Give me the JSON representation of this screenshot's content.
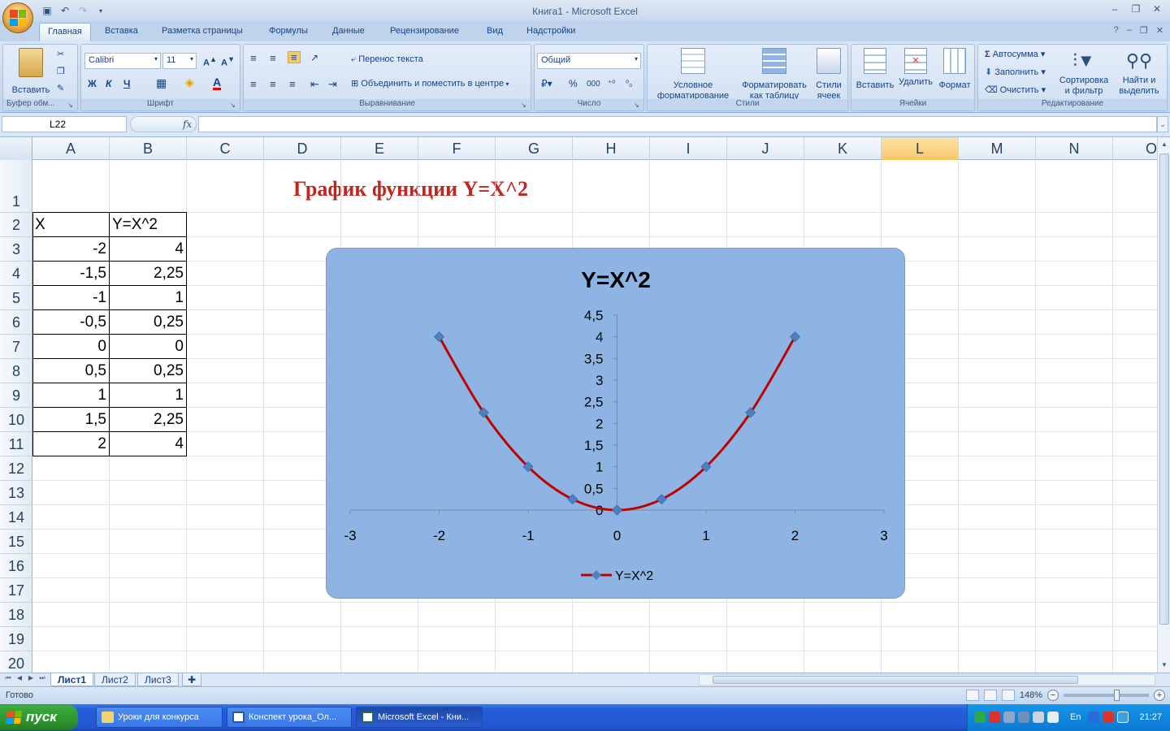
{
  "window": {
    "title": "Книга1 - Microsoft Excel",
    "min": "–",
    "restore": "❐",
    "close": "✕"
  },
  "ribbon_tabs": [
    "Главная",
    "Вставка",
    "Разметка страницы",
    "Формулы",
    "Данные",
    "Рецензирование",
    "Вид",
    "Надстройки"
  ],
  "ribbon": {
    "clipboard": {
      "paste": "Вставить",
      "label": "Буфер обм..."
    },
    "font": {
      "name": "Calibri",
      "size": "11",
      "bold": "Ж",
      "italic": "К",
      "underline": "Ч",
      "label": "Шрифт"
    },
    "alignment": {
      "wrap": "Перенос текста",
      "merge": "Объединить и поместить в центре",
      "label": "Выравнивание"
    },
    "number": {
      "format": "Общий",
      "percent": "%",
      "thousands": "000",
      "label": "Число"
    },
    "styles": {
      "conditional": "Условное форматирование",
      "as_table": "Форматировать как таблицу",
      "cell_styles": "Стили ячеек",
      "label": "Стили"
    },
    "cells": {
      "insert": "Вставить",
      "delete": "Удалить",
      "format": "Формат",
      "label": "Ячейки"
    },
    "editing": {
      "autosum": "Автосумма",
      "fill": "Заполнить",
      "clear": "Очистить",
      "sort": "Сортировка и фильтр",
      "find": "Найти и выделить",
      "label": "Редактирование"
    }
  },
  "formula_bar": {
    "name_box": "L22",
    "fx": "fx",
    "formula": ""
  },
  "columns": [
    "A",
    "B",
    "C",
    "D",
    "E",
    "F",
    "G",
    "H",
    "I",
    "J",
    "K",
    "L",
    "M",
    "N",
    "O"
  ],
  "rows": [
    "1",
    "2",
    "3",
    "4",
    "5",
    "6",
    "7",
    "8",
    "9",
    "10",
    "11",
    "12",
    "13",
    "14",
    "15",
    "16",
    "17",
    "18",
    "19",
    "20"
  ],
  "selected_column": "L",
  "sheet_title": "График функции Y=X^2",
  "table": {
    "headers": [
      "X",
      "Y=X^2"
    ],
    "rows": [
      [
        "-2",
        "4"
      ],
      [
        "-1,5",
        "2,25"
      ],
      [
        "-1",
        "1"
      ],
      [
        "-0,5",
        "0,25"
      ],
      [
        "0",
        "0"
      ],
      [
        "0,5",
        "0,25"
      ],
      [
        "1",
        "1"
      ],
      [
        "1,5",
        "2,25"
      ],
      [
        "2",
        "4"
      ]
    ]
  },
  "chart_data": {
    "type": "scatter",
    "title": "Y=X^2",
    "x": [
      -2,
      -1.5,
      -1,
      -0.5,
      0,
      0.5,
      1,
      1.5,
      2
    ],
    "series": [
      {
        "name": "Y=X^2",
        "values": [
          4,
          2.25,
          1,
          0.25,
          0,
          0.25,
          1,
          2.25,
          4
        ],
        "color": "#c00000",
        "marker_color": "#4f81bd",
        "marker": "diamond",
        "smooth": true
      }
    ],
    "xlim": [
      -3,
      3
    ],
    "ylim": [
      0,
      4.5
    ],
    "x_ticks": [
      "-3",
      "-2",
      "-1",
      "0",
      "1",
      "2",
      "3"
    ],
    "y_ticks": [
      "0",
      "0,5",
      "1",
      "1,5",
      "2",
      "2,5",
      "3",
      "3,5",
      "4",
      "4,5"
    ],
    "legend": "bottom",
    "background": "#8eb4e3",
    "grid": false
  },
  "sheets": [
    "Лист1",
    "Лист2",
    "Лист3"
  ],
  "active_sheet": "Лист1",
  "status": {
    "text": "Готово",
    "zoom": "148%"
  },
  "taskbar": {
    "start": "пуск",
    "tasks": [
      "Уроки для конкурса",
      "Конспект урока_Ол...",
      "Microsoft Excel - Кни..."
    ],
    "lang": "En",
    "clock": "21:27"
  }
}
